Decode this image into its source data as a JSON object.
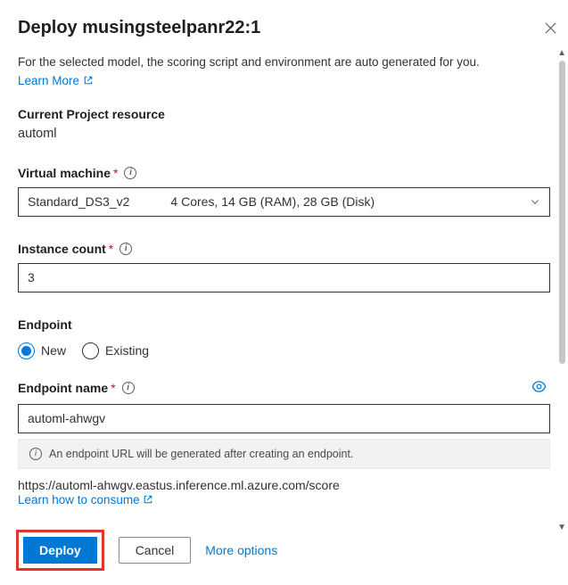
{
  "header": {
    "title": "Deploy musingsteelpanr22:1"
  },
  "intro": {
    "description": "For the selected model, the scoring script and environment are auto generated for you.",
    "learn_more": "Learn More"
  },
  "project_resource": {
    "label": "Current Project resource",
    "value": "automl"
  },
  "virtual_machine": {
    "label": "Virtual machine",
    "selected_name": "Standard_DS3_v2",
    "selected_spec": "4 Cores, 14 GB (RAM), 28 GB (Disk)"
  },
  "instance_count": {
    "label": "Instance count",
    "value": "3"
  },
  "endpoint": {
    "label": "Endpoint",
    "options": {
      "new": "New",
      "existing": "Existing"
    },
    "selected": "new"
  },
  "endpoint_name": {
    "label": "Endpoint name",
    "value": "automl-ahwgv",
    "info_message": "An endpoint URL will be generated after creating an endpoint.",
    "url": "https://automl-ahwgv.eastus.inference.ml.azure.com/score",
    "learn_link": "Learn how to consume"
  },
  "footer": {
    "deploy": "Deploy",
    "cancel": "Cancel",
    "more": "More options"
  }
}
